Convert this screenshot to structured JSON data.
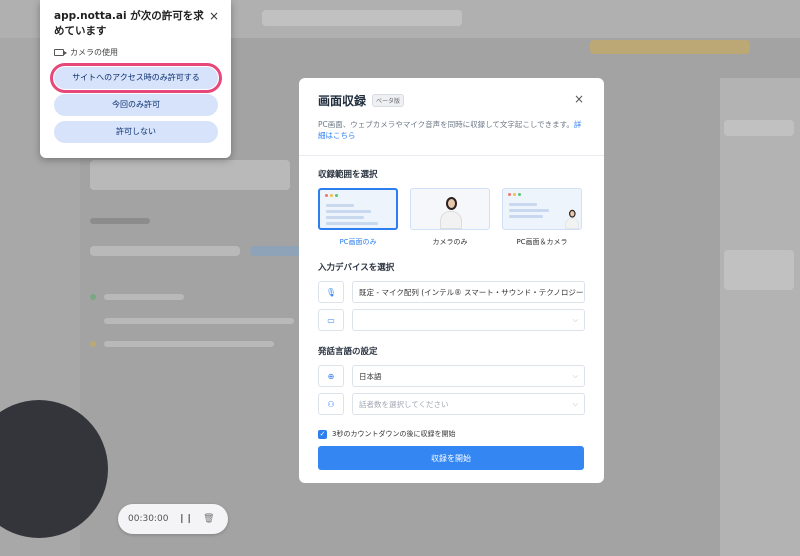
{
  "permission_popup": {
    "title": "app.notta.ai が次の許可を求めています",
    "close_symbol": "×",
    "camera_label": "カメラの使用",
    "buttons": [
      "サイトへのアクセス時のみ許可する",
      "今回のみ許可",
      "許可しない"
    ],
    "highlight_color": "#ea3f73"
  },
  "dialog": {
    "title": "画面収録",
    "badge": "ベータ版",
    "close_symbol": "×",
    "description": "PC画面、ウェブカメラやマイク音声を同時に収録して文字起こしできます。",
    "detail_link": "詳細はこちら",
    "section_range": "収録範囲を選択",
    "modes": [
      {
        "label": "PC画面のみ",
        "selected": true
      },
      {
        "label": "カメラのみ",
        "selected": false
      },
      {
        "label": "PC画面＆カメラ",
        "selected": false
      }
    ],
    "section_input": "入力デバイスを選択",
    "mic_value": "既定 - マイク配列 (インテル® スマート・サウンド・テクノロジー)",
    "camera_value": "",
    "section_language": "発話言語の設定",
    "language_value": "日本語",
    "speakers_placeholder": "話者数を選択してください",
    "countdown_label": "3秒のカウントダウンの後に収録を開始",
    "countdown_checked": true,
    "start_button": "収録を開始",
    "accent_color": "#2d7ff0"
  },
  "recorder_bar": {
    "time": "00:30:00",
    "pause_icon": "pause-icon",
    "delete_icon": "trash-icon"
  },
  "icons": {
    "mic": "🎙",
    "video": "▭",
    "globe": "⊕",
    "person": "⚇",
    "chevron": "⌵",
    "check": "✓"
  }
}
